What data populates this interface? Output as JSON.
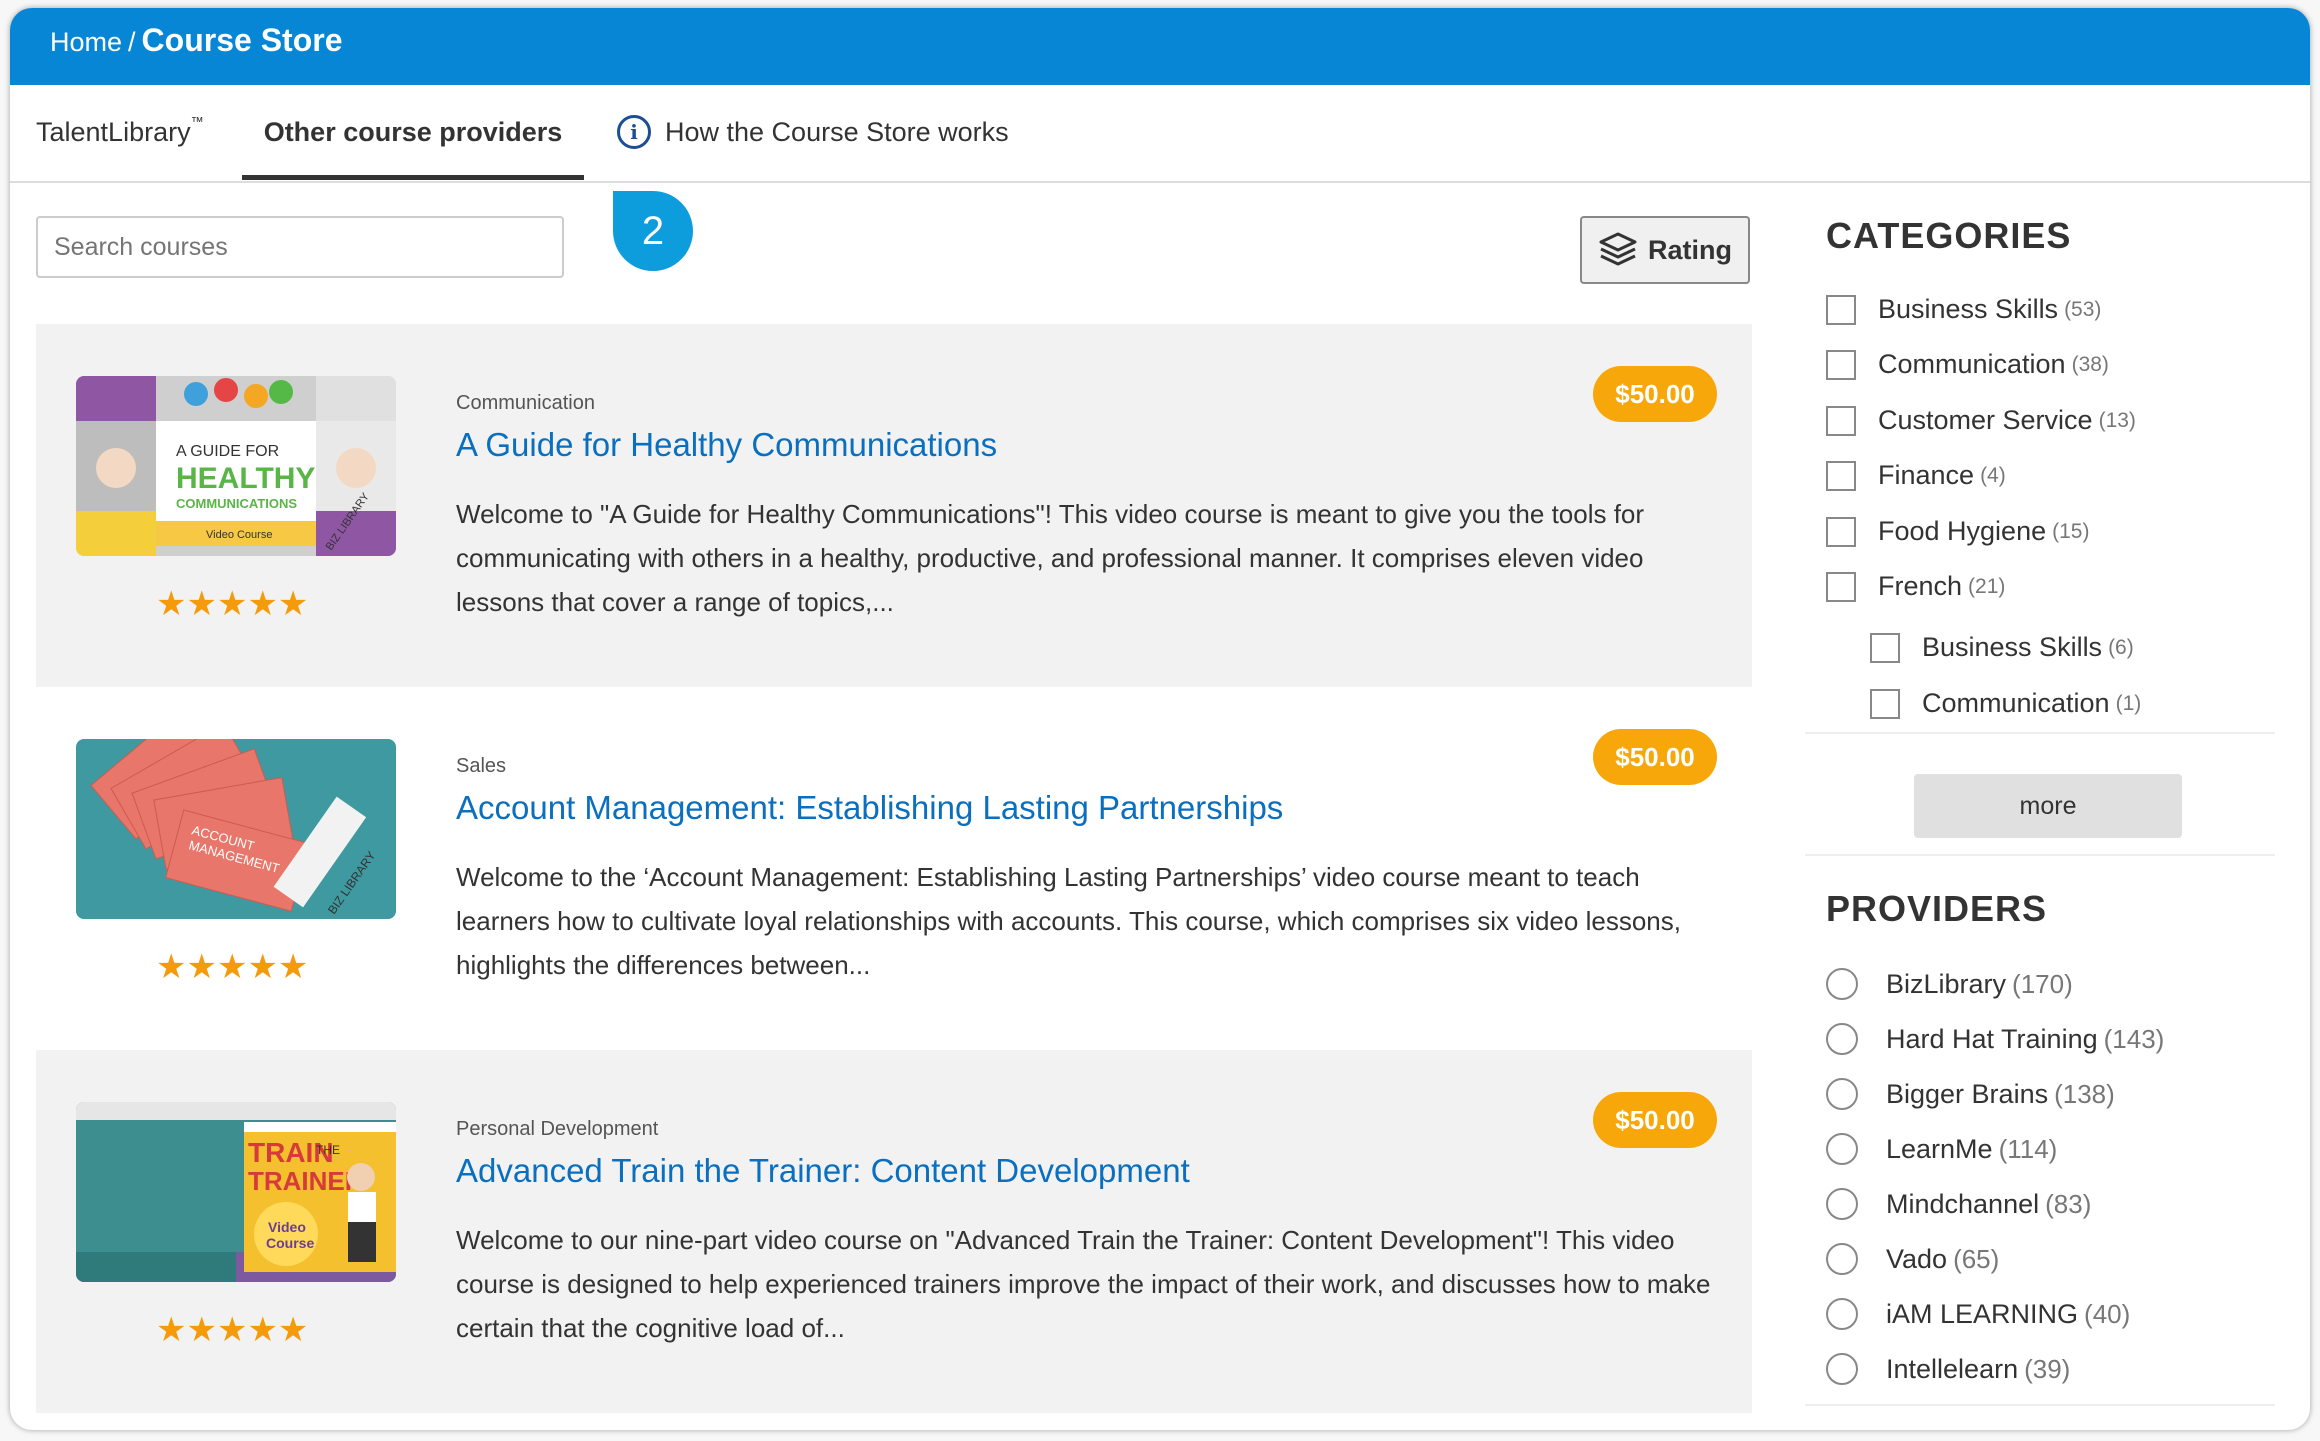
{
  "breadcrumb": {
    "home": "Home",
    "separator": "/",
    "current": "Course Store"
  },
  "tabs": [
    {
      "label": "TalentLibrary",
      "tm": "™"
    },
    {
      "label": "Other course providers",
      "active": true
    },
    {
      "label": "How the Course Store works",
      "icon": "info-icon"
    }
  ],
  "step_bubble": "2",
  "search": {
    "placeholder": "Search courses"
  },
  "sort_button": {
    "label": "Rating",
    "icon": "layers-icon"
  },
  "courses": [
    {
      "category": "Communication",
      "title": "A Guide for Healthy Communications",
      "description": "Welcome to \"A Guide for Healthy Communications\"! This video course is meant to give you the tools for communicating with others in a healthy, productive, and professional manner. It comprises eleven video lessons that cover a range of topics,...",
      "price": "$50.00",
      "rating": 5
    },
    {
      "category": "Sales",
      "title": "Account Management: Establishing Lasting Partnerships",
      "description": "Welcome to the ‘Account Management: Establishing Lasting Partnerships’ video course meant to teach learners how to cultivate loyal relationships with accounts. This course, which comprises six video lessons, highlights the differences between...",
      "price": "$50.00",
      "rating": 5
    },
    {
      "category": "Personal Development",
      "title": "Advanced Train the Trainer: Content Development",
      "description": "Welcome to our nine-part video course on \"Advanced Train the Trainer: Content Development\"! This video course is designed to help experienced trainers improve the impact of their work, and discusses how to make certain that the cognitive load of...",
      "price": "$50.00",
      "rating": 5
    }
  ],
  "thumbs": {
    "t1": {
      "line1": "A GUIDE FOR",
      "line2": "HEALTHY",
      "line3": "COMMUNICATIONS",
      "tag": "Video Course",
      "brand": "BIZ LIBRARY"
    },
    "t2": {
      "line1": "ACCOUNT",
      "line2": "MANAGEMENT",
      "brand": "BIZ LIBRARY"
    },
    "t3": {
      "line1": "TRAIN",
      "line2": "THE",
      "line3": "TRAINER",
      "tag1": "Video",
      "tag2": "Course"
    }
  },
  "categories": {
    "heading": "CATEGORIES",
    "items": [
      {
        "label": "Business Skills",
        "count": "(53)"
      },
      {
        "label": "Communication",
        "count": "(38)"
      },
      {
        "label": "Customer Service",
        "count": "(13)"
      },
      {
        "label": "Finance",
        "count": "(4)"
      },
      {
        "label": "Food Hygiene",
        "count": "(15)"
      },
      {
        "label": "French",
        "count": "(21)"
      },
      {
        "label": "Business Skills",
        "count": "(6)",
        "sub": true
      },
      {
        "label": "Communication",
        "count": "(1)",
        "sub": true
      }
    ],
    "more_label": "more"
  },
  "providers": {
    "heading": "PROVIDERS",
    "items": [
      {
        "label": "BizLibrary",
        "count": "(170)"
      },
      {
        "label": "Hard Hat Training",
        "count": "(143)"
      },
      {
        "label": "Bigger Brains",
        "count": "(138)"
      },
      {
        "label": "LearnMe",
        "count": "(114)"
      },
      {
        "label": "Mindchannel",
        "count": "(83)"
      },
      {
        "label": "Vado",
        "count": "(65)"
      },
      {
        "label": "iAM LEARNING",
        "count": "(40)"
      },
      {
        "label": "Intellelearn",
        "count": "(39)"
      }
    ]
  },
  "colors": {
    "header": "#0786d6",
    "link": "#0a6fbf",
    "price": "#f8a70b",
    "star": "#f59a0b",
    "bubble": "#0d9cdc"
  }
}
